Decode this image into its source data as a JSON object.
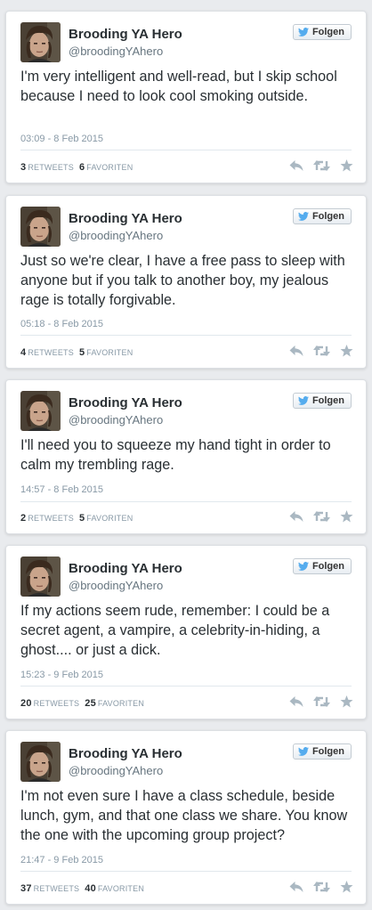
{
  "follow_label": "Folgen",
  "retweets_label": "RETWEETS",
  "favorites_label": "FAVORITEN",
  "tweets": [
    {
      "name": "Brooding YA Hero",
      "handle": "@broodingYAhero",
      "text": "I'm very intelligent and well-read, but I skip school because I need to look cool smoking outside.",
      "timestamp": "03:09 - 8 Feb 2015",
      "retweets": "3",
      "favorites": "6"
    },
    {
      "name": "Brooding YA Hero",
      "handle": "@broodingYAhero",
      "text": "Just so we're clear, I have a free pass to sleep with anyone but if you talk to another boy, my jealous rage is totally forgivable.",
      "timestamp": "05:18 - 8 Feb 2015",
      "retweets": "4",
      "favorites": "5"
    },
    {
      "name": "Brooding YA Hero",
      "handle": "@broodingYAhero",
      "text": "I'll need you to squeeze my hand tight in order to calm my trembling rage.",
      "timestamp": "14:57 - 8 Feb 2015",
      "retweets": "2",
      "favorites": "5"
    },
    {
      "name": "Brooding YA Hero",
      "handle": "@broodingYAhero",
      "text": "If my actions seem rude, remember: I could be a secret agent, a vampire, a celebrity-in-hiding, a ghost.... or just a dick.",
      "timestamp": "15:23 - 9 Feb 2015",
      "retweets": "20",
      "favorites": "25"
    },
    {
      "name": "Brooding YA Hero",
      "handle": "@broodingYAhero",
      "text": "I'm not even sure I have a class schedule, beside lunch, gym, and that one class we share. You know the one with the upcoming group project?",
      "timestamp": "21:47 - 9 Feb 2015",
      "retweets": "37",
      "favorites": "40"
    }
  ],
  "colors": {
    "page_background": "#e9ebee",
    "card_background": "#ffffff",
    "text": "#292f33",
    "muted": "#8899a6",
    "twitter_blue": "#55acee",
    "action_icon": "#aab8c2"
  },
  "icons": [
    "avatar-photo",
    "twitter-bird-icon",
    "reply-icon",
    "retweet-icon",
    "favorite-star-icon"
  ]
}
